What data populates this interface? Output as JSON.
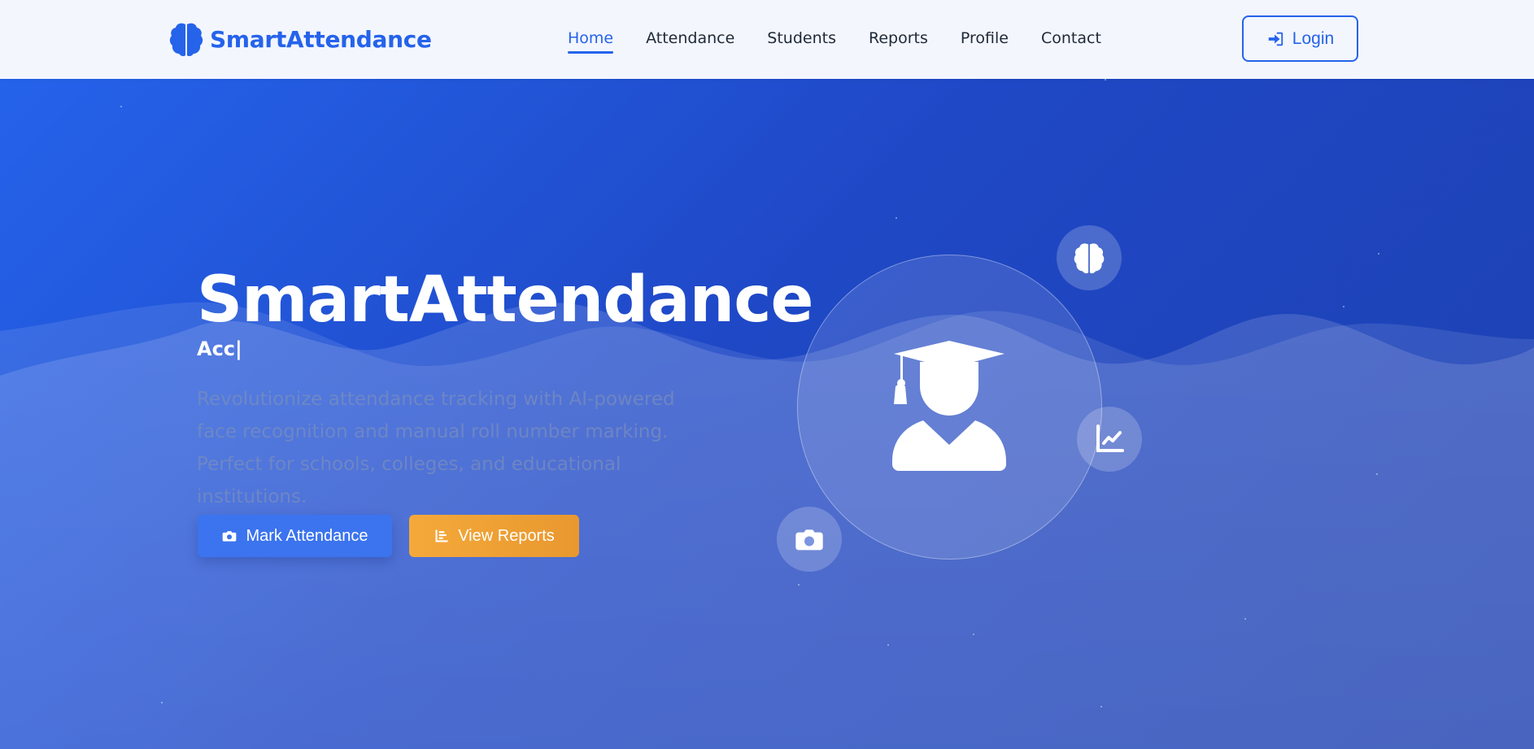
{
  "brand": {
    "name": "SmartAttendance",
    "icon": "brain-icon"
  },
  "nav": {
    "items": [
      {
        "label": "Home",
        "active": true
      },
      {
        "label": "Attendance",
        "active": false
      },
      {
        "label": "Students",
        "active": false
      },
      {
        "label": "Reports",
        "active": false
      },
      {
        "label": "Profile",
        "active": false
      },
      {
        "label": "Contact",
        "active": false
      }
    ],
    "login_label": "Login",
    "login_icon": "sign-in-icon"
  },
  "hero": {
    "title": "SmartAttendance",
    "typed_text": "Acc|",
    "description": "Revolutionize attendance tracking with AI-powered face recognition and manual roll number marking. Perfect for schools, colleges, and educational institutions.",
    "primary_button": {
      "label": "Mark Attendance",
      "icon": "camera-icon"
    },
    "secondary_button": {
      "label": "View Reports",
      "icon": "bar-chart-icon"
    },
    "illustration_icons": [
      "graduate-icon",
      "brain-icon",
      "chart-line-icon",
      "camera-icon"
    ]
  },
  "colors": {
    "accent": "#2563eb",
    "nav_bg": "#f3f6fd",
    "warning": "#f5a93a",
    "hero_start": "#2563eb",
    "hero_end": "#1e40af"
  }
}
